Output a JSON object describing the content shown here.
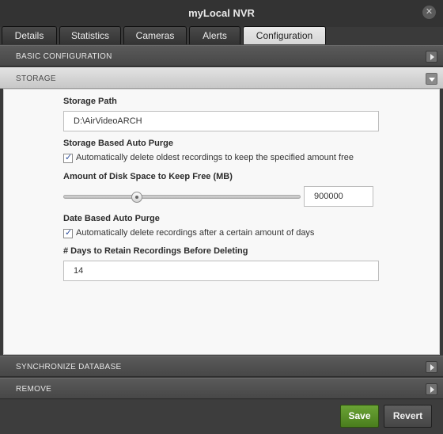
{
  "window": {
    "title": "myLocal NVR"
  },
  "tabs": [
    {
      "label": "Details"
    },
    {
      "label": "Statistics"
    },
    {
      "label": "Cameras"
    },
    {
      "label": "Alerts"
    },
    {
      "label": "Configuration",
      "active": true
    }
  ],
  "sections": {
    "basic": {
      "label": "BASIC CONFIGURATION",
      "expanded": false
    },
    "storage": {
      "label": "STORAGE",
      "expanded": true
    },
    "sync": {
      "label": "SYNCHRONIZE DATABASE",
      "expanded": false
    },
    "remove": {
      "label": "REMOVE",
      "expanded": false
    }
  },
  "storage": {
    "path_label": "Storage Path",
    "path_value": "D:\\AirVideoARCH",
    "auto_purge_label": "Storage Based Auto Purge",
    "auto_purge_check_text": "Automatically delete oldest recordings to keep the specified amount free",
    "auto_purge_checked": true,
    "disk_space_label": "Amount of Disk Space to Keep Free (MB)",
    "disk_space_value": "900000",
    "disk_space_slider_fraction": 0.3,
    "date_purge_label": "Date Based Auto Purge",
    "date_purge_check_text": "Automatically delete recordings after a certain amount of days",
    "date_purge_checked": true,
    "retain_days_label": "# Days to Retain Recordings Before Deleting",
    "retain_days_value": "14"
  },
  "footer": {
    "save_label": "Save",
    "revert_label": "Revert"
  },
  "colors": {
    "save_button": "#5a9028",
    "active_tab": "#e2e2e2",
    "checkmark": "#2d4e9c"
  },
  "icons": {
    "close": "close-icon",
    "collapsed": "chevron-right-icon",
    "expanded": "chevron-down-icon"
  }
}
